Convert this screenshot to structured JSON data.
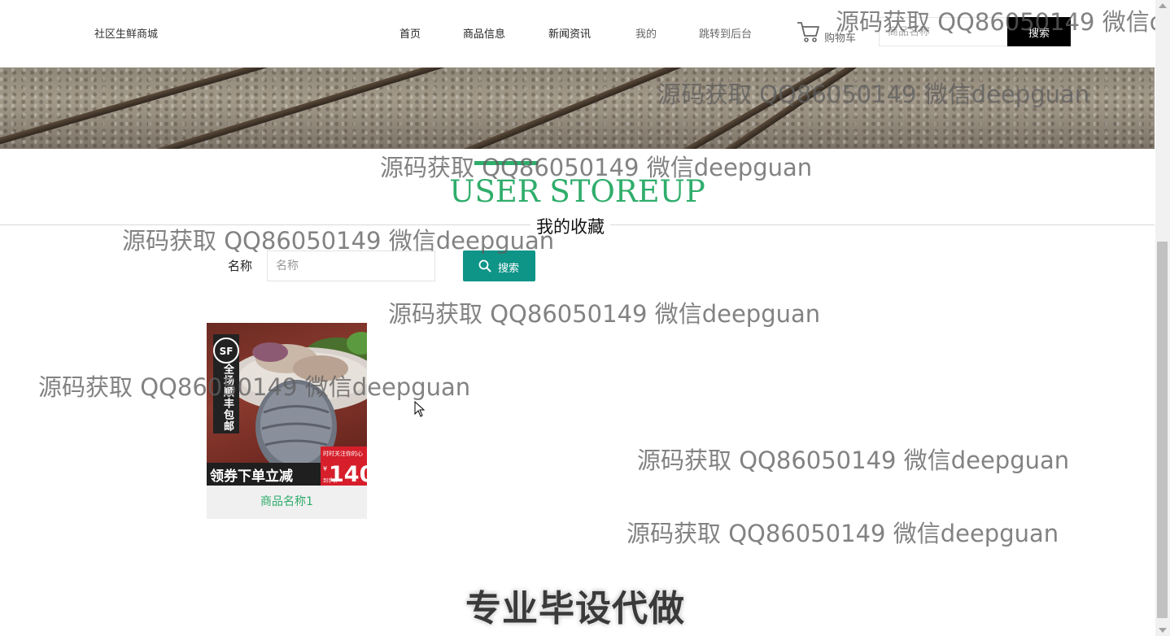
{
  "header": {
    "brand": "社区生鲜商城",
    "nav": [
      {
        "label": "首页"
      },
      {
        "label": "商品信息"
      },
      {
        "label": "新闻资讯"
      },
      {
        "label": "我的"
      },
      {
        "label": "跳转到后台"
      }
    ],
    "cart_label": "购物车",
    "search_placeholder": "商品名称",
    "search_button": "搜索"
  },
  "section": {
    "title_en": "USER STOREUP",
    "title_cn": "我的收藏"
  },
  "filter": {
    "label": "名称",
    "placeholder": "名称",
    "button": "搜索"
  },
  "products": [
    {
      "name": "商品名称1",
      "image_text": {
        "badge": "全场顺丰包邮",
        "logo": "SF",
        "promo": "领券下单立减",
        "price": "140",
        "currency": "¥",
        "note": "时时关注你的心",
        "price_label": "到手价"
      }
    }
  ],
  "watermarks": [
    "源码获取 QQ86050149 微信d",
    "源码获取 QQ86050149 微信deepguan",
    "源码获取 QQ86050149 微信deepguan",
    "源码获取 QQ86050149 微信deepguan",
    "源码获取 QQ86050149 微信deepguan",
    "源码获取 QQ86050149 微信deepguan",
    "源码获取 QQ86050149 微信deepguan",
    "源码获取 QQ86050149 微信deepguan"
  ],
  "footer_watermark": "专业毕设代做",
  "colors": {
    "accent": "#2fad6b",
    "button_teal": "#0f9488",
    "header_button": "#000000"
  }
}
